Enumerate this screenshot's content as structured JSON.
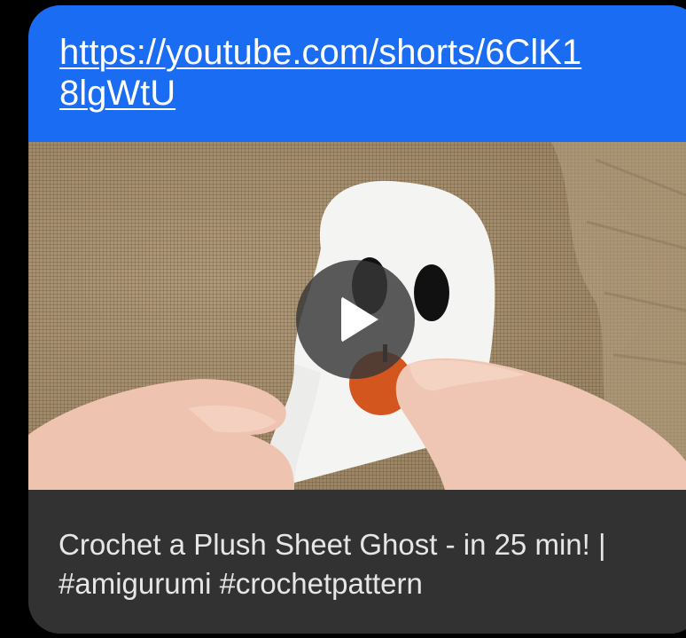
{
  "message": {
    "link_url": "https://youtube.com/shorts/6ClK18lgWtU",
    "video_title": "Crochet a Plush Sheet Ghost - in 25 min! | #amigurumi #crochetpattern"
  },
  "colors": {
    "link_background": "#1a6cf2",
    "title_background": "#323232",
    "page_background": "#000000"
  },
  "icons": {
    "play": "play-icon"
  }
}
